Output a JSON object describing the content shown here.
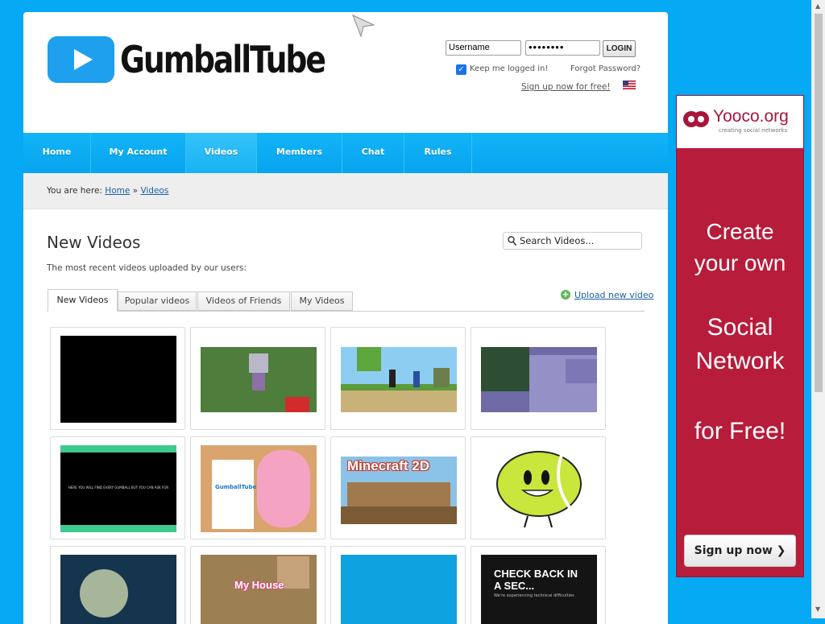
{
  "header": {
    "logo_text": "GumballTube",
    "username_field": "Username",
    "password_field": "••••••••",
    "login_button": "LOGIN",
    "keep_logged_in": "Keep me logged in!",
    "forgot_password": "Forgot Password?",
    "signup_link": "Sign up now for free!"
  },
  "nav": {
    "items": [
      "Home",
      "My Account",
      "Videos",
      "Members",
      "Chat",
      "Rules"
    ],
    "active": "Videos"
  },
  "breadcrumb": {
    "prefix": "You are here:",
    "home": "Home",
    "separator": "»",
    "current": "Videos"
  },
  "main": {
    "title": "New Videos",
    "subtitle": "The most recent videos uploaded by our users:",
    "search_placeholder": "Search Videos...",
    "tabs": [
      "New Videos",
      "Popular videos",
      "Videos of Friends",
      "My Videos"
    ],
    "upload_link": "Upload new video",
    "thumbnails": [
      {
        "name": "video-thumbnail-1"
      },
      {
        "name": "video-thumbnail-2"
      },
      {
        "name": "video-thumbnail-3"
      },
      {
        "name": "video-thumbnail-4"
      },
      {
        "name": "video-thumbnail-5",
        "caption": "HERE YOU WILL FIND EVERY GUMBALL BUT YOU CAN ASK FOR"
      },
      {
        "name": "video-thumbnail-6",
        "caption": "GumballTube"
      },
      {
        "name": "video-thumbnail-7",
        "caption": "Minecraft 2D"
      },
      {
        "name": "video-thumbnail-8"
      },
      {
        "name": "video-thumbnail-9"
      },
      {
        "name": "video-thumbnail-10",
        "caption": "My House"
      },
      {
        "name": "video-thumbnail-11"
      },
      {
        "name": "video-thumbnail-12",
        "caption": "CHECK BACK IN A SEC...",
        "subcaption": "We're experiencing technical difficulties"
      }
    ]
  },
  "ad": {
    "brand": "Yooco.org",
    "tagline": "creating social networks",
    "lines": [
      "Create",
      "your own",
      "Social",
      "Network",
      "for Free!"
    ],
    "button": "Sign up now ❯"
  },
  "colors": {
    "background": "#05a9f4",
    "nav": "#0aa8f2",
    "ad": "#b71c3a"
  }
}
